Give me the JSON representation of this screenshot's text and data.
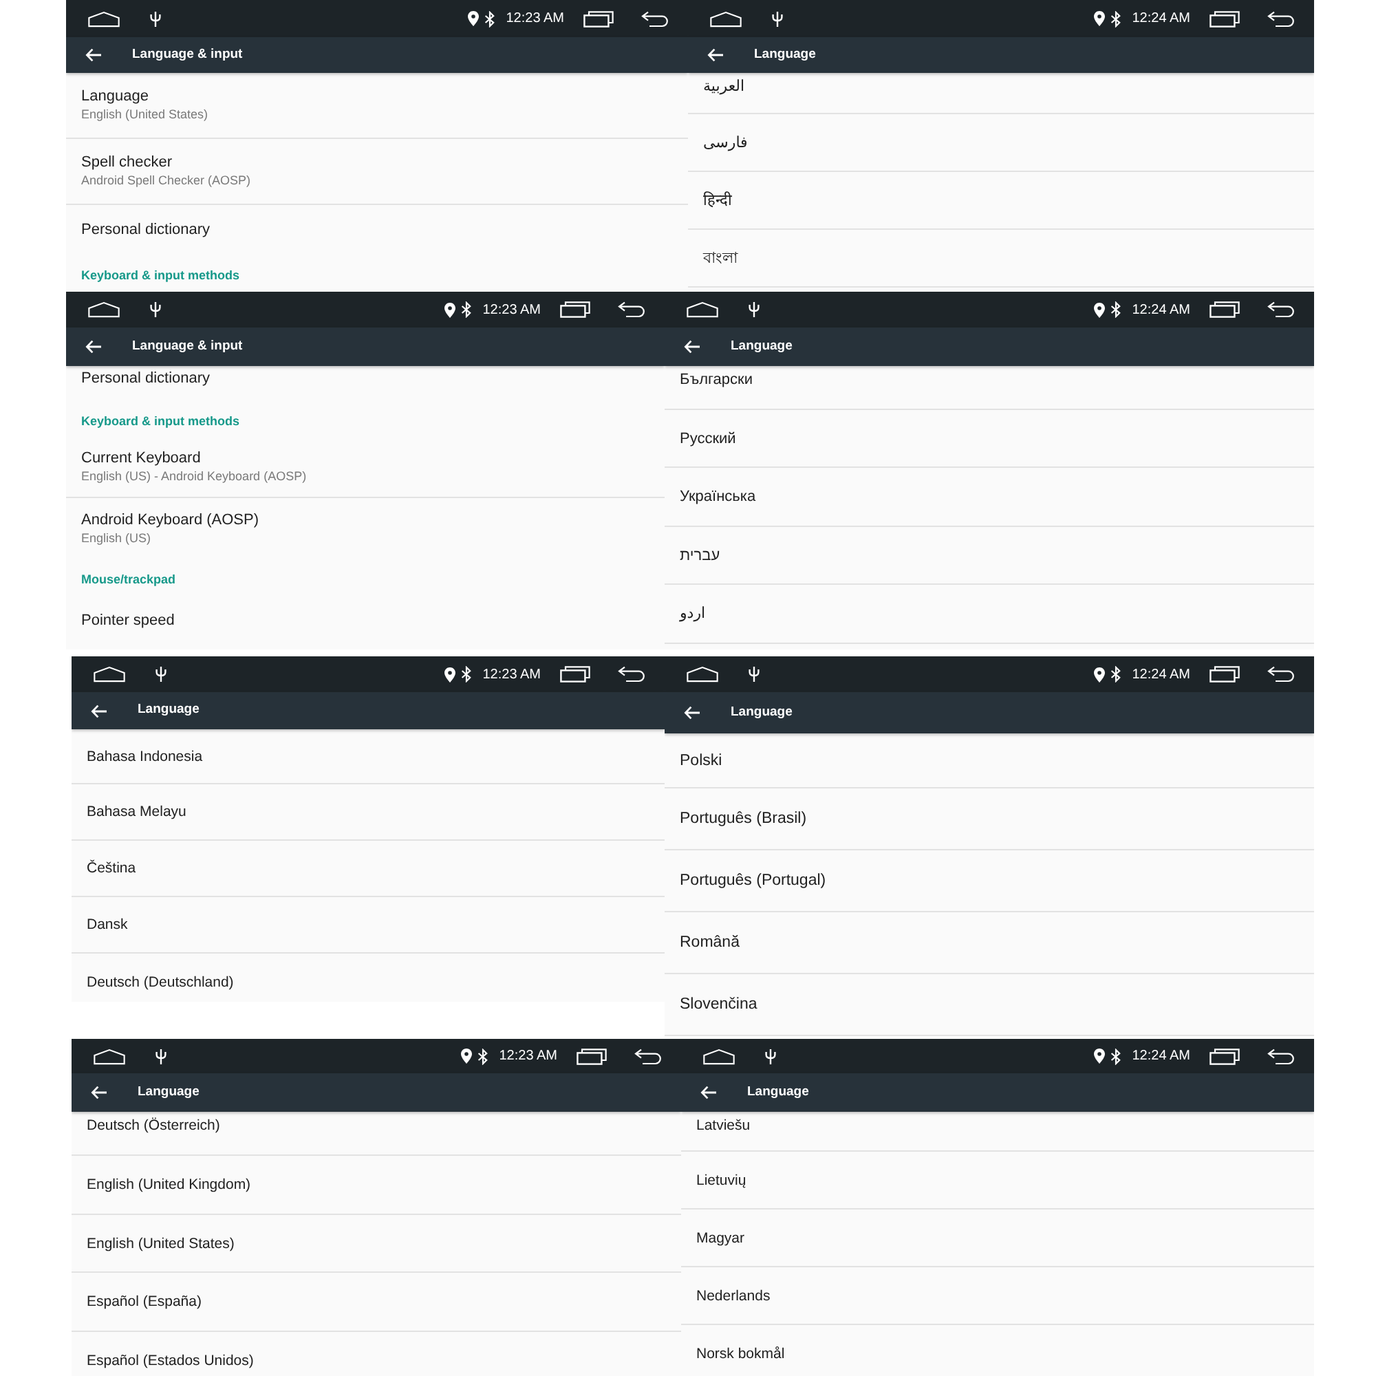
{
  "panels": [
    {
      "status_bar": {
        "time": "12:23 AM"
      },
      "toolbar": {
        "title": "Language & input"
      },
      "items": [
        {
          "kind": "setting",
          "title": "Language",
          "summary": "English (United States)"
        },
        {
          "kind": "setting",
          "title": "Spell checker",
          "summary": "Android Spell Checker (AOSP)"
        },
        {
          "kind": "setting",
          "title": "Personal dictionary"
        },
        {
          "kind": "header",
          "title": "Keyboard & input methods"
        }
      ]
    },
    {
      "status_bar": {
        "time": "12:24 AM"
      },
      "toolbar": {
        "title": "Language"
      },
      "items": [
        {
          "kind": "language",
          "title": "العربية"
        },
        {
          "kind": "language",
          "title": "فارسی"
        },
        {
          "kind": "language",
          "title": "हिन्दी"
        },
        {
          "kind": "language",
          "title": "বাংলা"
        }
      ]
    },
    {
      "status_bar": {
        "time": "12:23 AM"
      },
      "toolbar": {
        "title": "Language & input"
      },
      "items": [
        {
          "kind": "setting",
          "title": "Personal dictionary"
        },
        {
          "kind": "header",
          "title": "Keyboard & input methods"
        },
        {
          "kind": "setting",
          "title": "Current Keyboard",
          "summary": "English (US) - Android Keyboard (AOSP)"
        },
        {
          "kind": "setting",
          "title": "Android Keyboard (AOSP)",
          "summary": "English (US)"
        },
        {
          "kind": "header",
          "title": "Mouse/trackpad"
        },
        {
          "kind": "setting",
          "title": "Pointer speed"
        }
      ]
    },
    {
      "status_bar": {
        "time": "12:24 AM"
      },
      "toolbar": {
        "title": "Language"
      },
      "items": [
        {
          "kind": "language",
          "title": "Български"
        },
        {
          "kind": "language",
          "title": "Русский"
        },
        {
          "kind": "language",
          "title": "Українська"
        },
        {
          "kind": "language",
          "title": "עברית"
        },
        {
          "kind": "language",
          "title": "اردو"
        }
      ]
    },
    {
      "status_bar": {
        "time": "12:23 AM"
      },
      "toolbar": {
        "title": "Language"
      },
      "items": [
        {
          "kind": "language",
          "title": "Bahasa Indonesia"
        },
        {
          "kind": "language",
          "title": "Bahasa Melayu"
        },
        {
          "kind": "language",
          "title": "Čeština"
        },
        {
          "kind": "language",
          "title": "Dansk"
        },
        {
          "kind": "language",
          "title": "Deutsch (Deutschland)"
        }
      ]
    },
    {
      "status_bar": {
        "time": "12:24 AM"
      },
      "toolbar": {
        "title": "Language"
      },
      "items": [
        {
          "kind": "language",
          "title": "Polski"
        },
        {
          "kind": "language",
          "title": "Português (Brasil)"
        },
        {
          "kind": "language",
          "title": "Português (Portugal)"
        },
        {
          "kind": "language",
          "title": "Română"
        },
        {
          "kind": "language",
          "title": "Slovenčina"
        }
      ]
    },
    {
      "status_bar": {
        "time": "12:23 AM"
      },
      "toolbar": {
        "title": "Language"
      },
      "items": [
        {
          "kind": "language",
          "title": "Deutsch (Österreich)"
        },
        {
          "kind": "language",
          "title": "English (United Kingdom)"
        },
        {
          "kind": "language",
          "title": "English (United States)"
        },
        {
          "kind": "language",
          "title": "Español (España)"
        },
        {
          "kind": "language",
          "title": "Español (Estados Unidos)"
        }
      ]
    },
    {
      "status_bar": {
        "time": "12:24 AM"
      },
      "toolbar": {
        "title": "Language"
      },
      "items": [
        {
          "kind": "language",
          "title": "Latviešu"
        },
        {
          "kind": "language",
          "title": "Lietuvių"
        },
        {
          "kind": "language",
          "title": "Magyar"
        },
        {
          "kind": "language",
          "title": "Nederlands"
        },
        {
          "kind": "language",
          "title": "Norsk bokmål"
        }
      ]
    }
  ]
}
